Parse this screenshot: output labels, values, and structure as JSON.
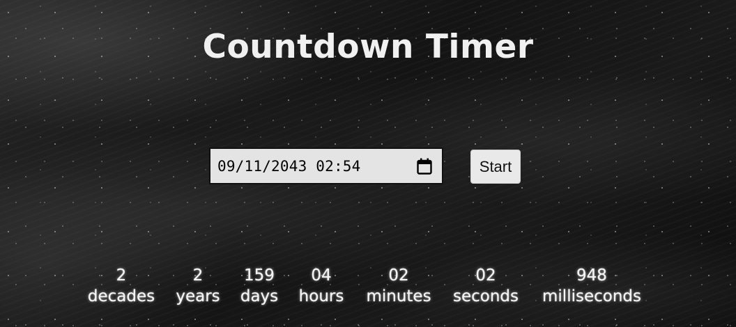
{
  "title": "Countdown Timer",
  "datetime_input": {
    "value": "09/11/2043 02:54",
    "icon": "calendar-icon"
  },
  "start_button": {
    "label": "Start"
  },
  "countdown": [
    {
      "value": "2",
      "label": "decades"
    },
    {
      "value": "2",
      "label": "years"
    },
    {
      "value": "159",
      "label": "days"
    },
    {
      "value": "04",
      "label": "hours"
    },
    {
      "value": "02",
      "label": "minutes"
    },
    {
      "value": "02",
      "label": "seconds"
    },
    {
      "value": "948",
      "label": "milliseconds"
    }
  ]
}
